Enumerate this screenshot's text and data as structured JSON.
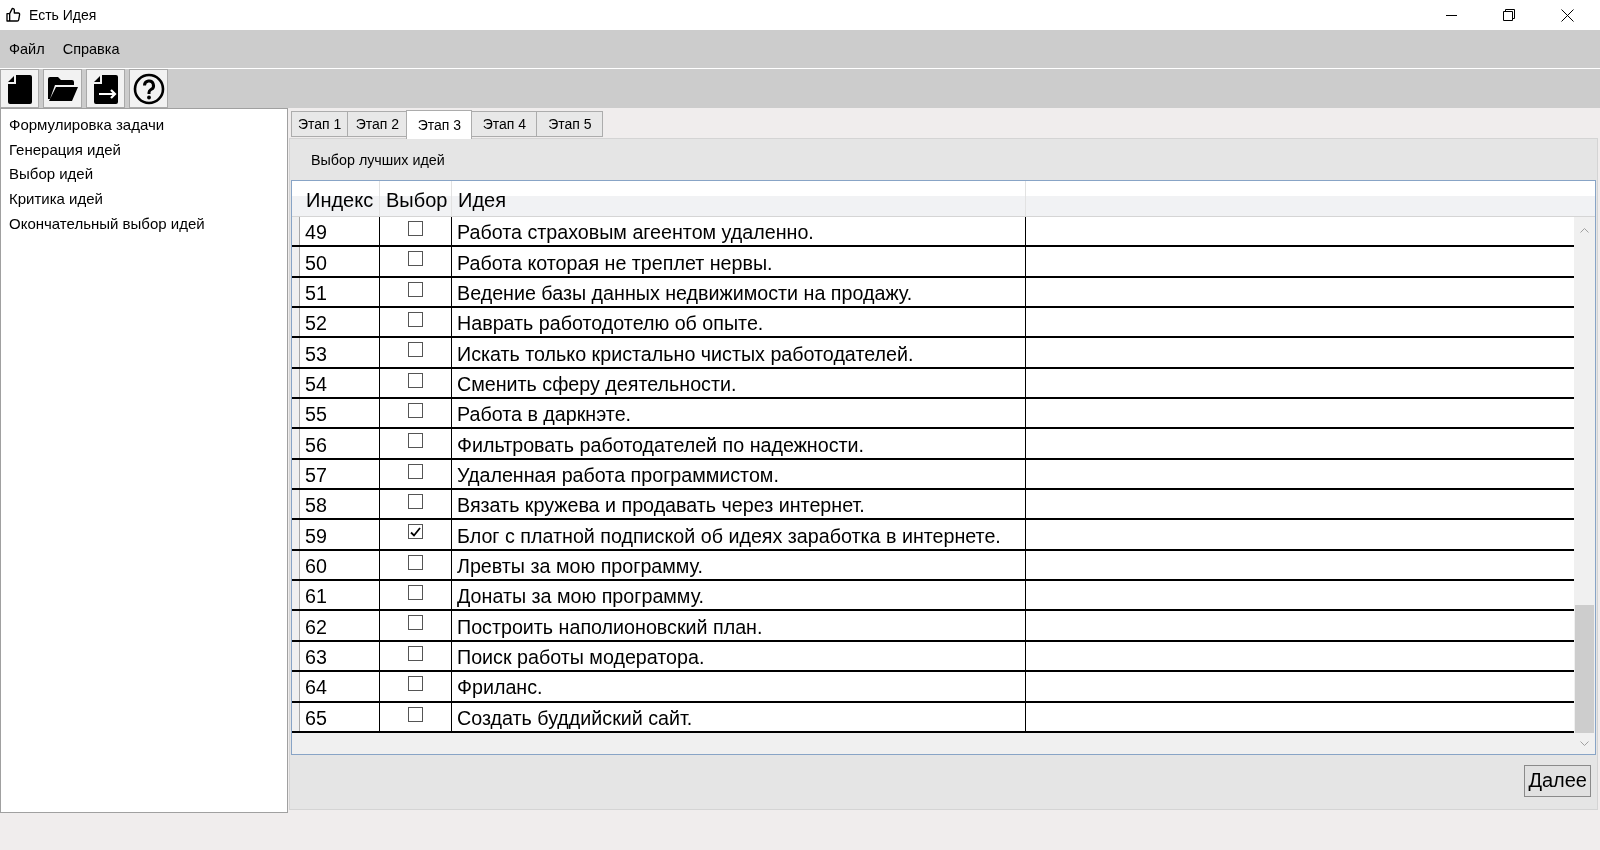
{
  "window": {
    "title": "Есть Идея"
  },
  "menu": [
    {
      "label": "Файл"
    },
    {
      "label": "Справка"
    }
  ],
  "sidebar": {
    "items": [
      {
        "label": "Формулировка задачи"
      },
      {
        "label": "Генерация идей"
      },
      {
        "label": "Выбор идей"
      },
      {
        "label": "Критика идей"
      },
      {
        "label": "Окончательный выбор идей"
      }
    ]
  },
  "tabs": [
    {
      "label": "Этап 1",
      "selected": false
    },
    {
      "label": "Этап 2",
      "selected": false
    },
    {
      "label": "Этап 3",
      "selected": true
    },
    {
      "label": "Этап 4",
      "selected": false
    },
    {
      "label": "Этап 5",
      "selected": false
    }
  ],
  "panel": {
    "heading": "Выбор лучших идей",
    "table": {
      "columns": [
        "Индекс",
        "Выбор",
        "Идея"
      ],
      "rows": [
        {
          "index": "49",
          "checked": false,
          "idea": "Работа страховым агеентом удаленно."
        },
        {
          "index": "50",
          "checked": false,
          "idea": "Работа которая не треплет нервы."
        },
        {
          "index": "51",
          "checked": false,
          "idea": "Ведение базы данных недвижимости на продажу."
        },
        {
          "index": "52",
          "checked": false,
          "idea": "Наврать работодотелю об опыте."
        },
        {
          "index": "53",
          "checked": false,
          "idea": "Искать только кристально чистых работодателей."
        },
        {
          "index": "54",
          "checked": false,
          "idea": "Сменить сферу деятельности."
        },
        {
          "index": "55",
          "checked": false,
          "idea": "Работа в даркнэте."
        },
        {
          "index": "56",
          "checked": false,
          "idea": "Фильтровать работодателей по надежности."
        },
        {
          "index": "57",
          "checked": false,
          "idea": "Удаленная работа программистом."
        },
        {
          "index": "58",
          "checked": false,
          "idea": "Вязать кружева и продавать через интернет."
        },
        {
          "index": "59",
          "checked": true,
          "idea": "Блог с платной подпиской об идеях заработка в интернете."
        },
        {
          "index": "60",
          "checked": false,
          "idea": "Лревты за мою программу."
        },
        {
          "index": "61",
          "checked": false,
          "idea": "Донаты за мою программу."
        },
        {
          "index": "62",
          "checked": false,
          "idea": "Построить наполионовский план."
        },
        {
          "index": "63",
          "checked": false,
          "idea": "Поиск работы модератора."
        },
        {
          "index": "64",
          "checked": false,
          "idea": "Фриланс."
        },
        {
          "index": "65",
          "checked": false,
          "idea": "Создать буддийский сайт."
        }
      ]
    },
    "buttons": [
      "Далее"
    ]
  }
}
